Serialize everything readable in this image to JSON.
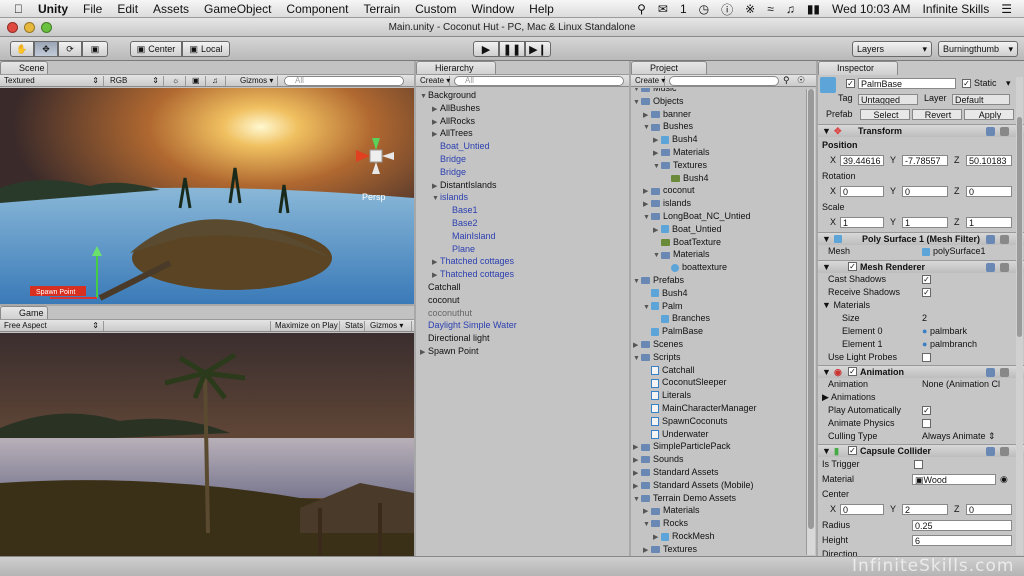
{
  "menubar": {
    "app": "Unity",
    "items": [
      "File",
      "Edit",
      "Assets",
      "GameObject",
      "Component",
      "Terrain",
      "Custom",
      "Window",
      "Help"
    ],
    "status": {
      "count": "1",
      "datetime": "Wed 10:03 AM",
      "user": "Infinite Skills"
    }
  },
  "window": {
    "title": "Main.unity - Coconut Hut - PC, Mac & Linux Standalone"
  },
  "toolbar": {
    "center": "Center",
    "local": "Local",
    "layers": "Layers",
    "layout": "Burningthumb"
  },
  "scene": {
    "tab": "Scene",
    "draw_mode": "Textured",
    "render_mode": "RGB",
    "gizmos": "Gizmos",
    "search": "All",
    "persp": "Persp",
    "label": "Spawn Point"
  },
  "game": {
    "tab": "Game",
    "aspect": "Free Aspect",
    "maximize": "Maximize on Play",
    "stats": "Stats",
    "gizmos": "Gizmos"
  },
  "hierarchy": {
    "tab": "Hierarchy",
    "create": "Create",
    "search": "All",
    "rows": [
      {
        "label": "Background",
        "depth": 0,
        "arrow": "▼",
        "style": ""
      },
      {
        "label": "AllBushes",
        "depth": 1,
        "arrow": "▶",
        "style": ""
      },
      {
        "label": "AllRocks",
        "depth": 1,
        "arrow": "▶",
        "style": ""
      },
      {
        "label": "AllTrees",
        "depth": 1,
        "arrow": "▶",
        "style": ""
      },
      {
        "label": "Boat_Untied",
        "depth": 1,
        "arrow": "",
        "style": "blue"
      },
      {
        "label": "Bridge",
        "depth": 1,
        "arrow": "",
        "style": "blue"
      },
      {
        "label": "Bridge",
        "depth": 1,
        "arrow": "",
        "style": "blue"
      },
      {
        "label": "DistantIslands",
        "depth": 1,
        "arrow": "▶",
        "style": ""
      },
      {
        "label": "islands",
        "depth": 1,
        "arrow": "▼",
        "style": "blue"
      },
      {
        "label": "Base1",
        "depth": 2,
        "arrow": "",
        "style": "blue"
      },
      {
        "label": "Base2",
        "depth": 2,
        "arrow": "",
        "style": "blue"
      },
      {
        "label": "MainIsland",
        "depth": 2,
        "arrow": "",
        "style": "blue"
      },
      {
        "label": "Plane",
        "depth": 2,
        "arrow": "",
        "style": "blue"
      },
      {
        "label": "Thatched cottages",
        "depth": 1,
        "arrow": "▶",
        "style": "blue"
      },
      {
        "label": "Thatched cottages",
        "depth": 1,
        "arrow": "▶",
        "style": "blue"
      },
      {
        "label": "Catchall",
        "depth": 0,
        "arrow": "",
        "style": ""
      },
      {
        "label": "coconut",
        "depth": 0,
        "arrow": "",
        "style": ""
      },
      {
        "label": "coconuthut",
        "depth": 0,
        "arrow": "",
        "style": "grey"
      },
      {
        "label": "Daylight Simple Water",
        "depth": 0,
        "arrow": "",
        "style": "blue"
      },
      {
        "label": "Directional light",
        "depth": 0,
        "arrow": "",
        "style": ""
      },
      {
        "label": "Spawn Point",
        "depth": 0,
        "arrow": "▶",
        "style": ""
      }
    ]
  },
  "project": {
    "tab": "Project",
    "create": "Create",
    "rows": [
      {
        "label": "Music",
        "depth": 0,
        "arrow": "▼",
        "icon": "folder"
      },
      {
        "label": "Objects",
        "depth": 0,
        "arrow": "▼",
        "icon": "folder"
      },
      {
        "label": "banner",
        "depth": 1,
        "arrow": "▶",
        "icon": "folder"
      },
      {
        "label": "Bushes",
        "depth": 1,
        "arrow": "▼",
        "icon": "folder"
      },
      {
        "label": "Bush4",
        "depth": 2,
        "arrow": "▶",
        "icon": "cube"
      },
      {
        "label": "Materials",
        "depth": 2,
        "arrow": "▶",
        "icon": "folder"
      },
      {
        "label": "Textures",
        "depth": 2,
        "arrow": "▼",
        "icon": "folder"
      },
      {
        "label": "Bush4",
        "depth": 3,
        "arrow": "",
        "icon": "texture"
      },
      {
        "label": "coconut",
        "depth": 1,
        "arrow": "▶",
        "icon": "folder"
      },
      {
        "label": "islands",
        "depth": 1,
        "arrow": "▶",
        "icon": "folder"
      },
      {
        "label": "LongBoat_NC_Untied",
        "depth": 1,
        "arrow": "▼",
        "icon": "folder"
      },
      {
        "label": "Boat_Untied",
        "depth": 2,
        "arrow": "▶",
        "icon": "cube"
      },
      {
        "label": "BoatTexture",
        "depth": 2,
        "arrow": "",
        "icon": "texture"
      },
      {
        "label": "Materials",
        "depth": 2,
        "arrow": "▼",
        "icon": "folder"
      },
      {
        "label": "boattexture",
        "depth": 3,
        "arrow": "",
        "icon": "material"
      },
      {
        "label": "Prefabs",
        "depth": 0,
        "arrow": "▼",
        "icon": "folder"
      },
      {
        "label": "Bush4",
        "depth": 1,
        "arrow": "",
        "icon": "cube"
      },
      {
        "label": "Palm",
        "depth": 1,
        "arrow": "▼",
        "icon": "cube"
      },
      {
        "label": "Branches",
        "depth": 2,
        "arrow": "",
        "icon": "cube"
      },
      {
        "label": "PalmBase",
        "depth": 1,
        "arrow": "",
        "icon": "cube"
      },
      {
        "label": "Scenes",
        "depth": 0,
        "arrow": "▶",
        "icon": "folder"
      },
      {
        "label": "Scripts",
        "depth": 0,
        "arrow": "▼",
        "icon": "folder"
      },
      {
        "label": "Catchall",
        "depth": 1,
        "arrow": "",
        "icon": "script"
      },
      {
        "label": "CoconutSleeper",
        "depth": 1,
        "arrow": "",
        "icon": "script"
      },
      {
        "label": "Literals",
        "depth": 1,
        "arrow": "",
        "icon": "script"
      },
      {
        "label": "MainCharacterManager",
        "depth": 1,
        "arrow": "",
        "icon": "script"
      },
      {
        "label": "SpawnCoconuts",
        "depth": 1,
        "arrow": "",
        "icon": "script"
      },
      {
        "label": "Underwater",
        "depth": 1,
        "arrow": "",
        "icon": "script"
      },
      {
        "label": "SimpleParticlePack",
        "depth": 0,
        "arrow": "▶",
        "icon": "folder"
      },
      {
        "label": "Sounds",
        "depth": 0,
        "arrow": "▶",
        "icon": "folder"
      },
      {
        "label": "Standard Assets",
        "depth": 0,
        "arrow": "▶",
        "icon": "folder"
      },
      {
        "label": "Standard Assets (Mobile)",
        "depth": 0,
        "arrow": "▶",
        "icon": "folder"
      },
      {
        "label": "Terrain Demo Assets",
        "depth": 0,
        "arrow": "▼",
        "icon": "folder"
      },
      {
        "label": "Materials",
        "depth": 1,
        "arrow": "▶",
        "icon": "folder"
      },
      {
        "label": "Rocks",
        "depth": 1,
        "arrow": "▼",
        "icon": "folder"
      },
      {
        "label": "RockMesh",
        "depth": 2,
        "arrow": "▶",
        "icon": "cube"
      },
      {
        "label": "Textures",
        "depth": 1,
        "arrow": "▶",
        "icon": "folder"
      }
    ]
  },
  "inspector": {
    "tab": "Inspector",
    "name": "PalmBase",
    "static": "Static",
    "tag_label": "Tag",
    "tag": "Untagged",
    "layer_label": "Layer",
    "layer": "Default",
    "prefab_label": "Prefab",
    "select": "Select",
    "revert": "Revert",
    "apply": "Apply",
    "transform": {
      "title": "Transform",
      "position": "Position",
      "rotation": "Rotation",
      "scale": "Scale",
      "x": "X",
      "y": "Y",
      "z": "Z",
      "pos": [
        "39.44616",
        "-7.78557",
        "50.10183"
      ],
      "rot": [
        "0",
        "0",
        "0"
      ],
      "scl": [
        "1",
        "1",
        "1"
      ]
    },
    "mesh_filter": {
      "title": "Poly Surface 1 (Mesh Filter)",
      "mesh_label": "Mesh",
      "mesh": "polySurface1"
    },
    "mesh_renderer": {
      "title": "Mesh Renderer",
      "cast": "Cast Shadows",
      "receive": "Receive Shadows",
      "materials": "Materials",
      "size_label": "Size",
      "size": "2",
      "el0_label": "Element 0",
      "el0": "palmbark",
      "el1_label": "Element 1",
      "el1": "palmbranch",
      "probes": "Use Light Probes"
    },
    "animation": {
      "title": "Animation",
      "anim_label": "Animation",
      "anim": "None (Animation Cl",
      "anims": "Animations",
      "play": "Play Automatically",
      "physics": "Animate Physics",
      "culling_label": "Culling Type",
      "culling": "Always Animate"
    },
    "collider": {
      "title": "Capsule Collider",
      "trigger": "Is Trigger",
      "material_label": "Material",
      "material": "Wood",
      "center": "Center",
      "cx": "0",
      "cy": "2",
      "cz": "0",
      "radius_label": "Radius",
      "radius": "0.25",
      "height_label": "Height",
      "height": "6",
      "direction": "Direction"
    }
  },
  "watermark": "InfiniteSkills.com"
}
